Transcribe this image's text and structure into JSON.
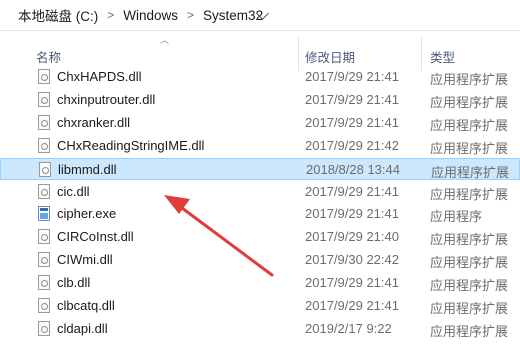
{
  "breadcrumb": {
    "items": [
      "本地磁盘 (C:)",
      "Windows",
      "System32"
    ],
    "separator": ">"
  },
  "columns": {
    "name": "名称",
    "date": "修改日期",
    "type": "类型"
  },
  "files": [
    {
      "name": "ChxHAPDS.dll",
      "date": "2017/9/29 21:41",
      "type": "应用程序扩展",
      "icon": "dll-file-icon",
      "selected": false
    },
    {
      "name": "chxinputrouter.dll",
      "date": "2017/9/29 21:41",
      "type": "应用程序扩展",
      "icon": "dll-file-icon",
      "selected": false
    },
    {
      "name": "chxranker.dll",
      "date": "2017/9/29 21:41",
      "type": "应用程序扩展",
      "icon": "dll-file-icon",
      "selected": false
    },
    {
      "name": "CHxReadingStringIME.dll",
      "date": "2017/9/29 21:42",
      "type": "应用程序扩展",
      "icon": "dll-file-icon",
      "selected": false
    },
    {
      "name": "libmmd.dll",
      "date": "2018/8/28 13:44",
      "type": "应用程序扩展",
      "icon": "dll-file-icon",
      "selected": true
    },
    {
      "name": "cic.dll",
      "date": "2017/9/29 21:41",
      "type": "应用程序扩展",
      "icon": "dll-file-icon",
      "selected": false
    },
    {
      "name": "cipher.exe",
      "date": "2017/9/29 21:41",
      "type": "应用程序",
      "icon": "exe-file-icon",
      "selected": false
    },
    {
      "name": "CIRCoInst.dll",
      "date": "2017/9/29 21:40",
      "type": "应用程序扩展",
      "icon": "dll-file-icon",
      "selected": false
    },
    {
      "name": "CIWmi.dll",
      "date": "2017/9/30 22:42",
      "type": "应用程序扩展",
      "icon": "dll-file-icon",
      "selected": false
    },
    {
      "name": "clb.dll",
      "date": "2017/9/29 21:41",
      "type": "应用程序扩展",
      "icon": "dll-file-icon",
      "selected": false
    },
    {
      "name": "clbcatq.dll",
      "date": "2017/9/29 21:41",
      "type": "应用程序扩展",
      "icon": "dll-file-icon",
      "selected": false
    },
    {
      "name": "cldapi.dll",
      "date": "2019/2/17 9:22",
      "type": "应用程序扩展",
      "icon": "dll-file-icon",
      "selected": false
    }
  ],
  "colors": {
    "selection": "#cce8ff",
    "selection_border": "#99d1ff",
    "annotation_arrow": "#e03c3c"
  }
}
